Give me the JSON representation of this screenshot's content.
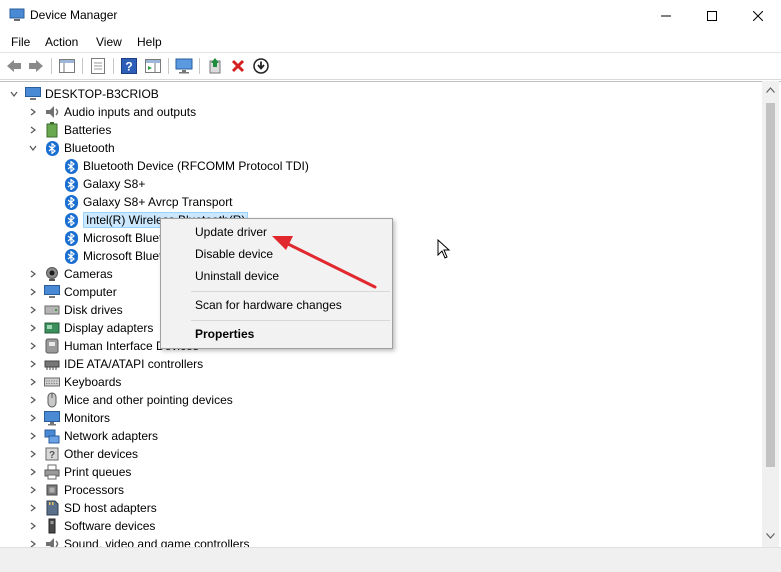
{
  "window": {
    "title": "Device Manager",
    "controls": {
      "minimize": "–",
      "maximize": "☐",
      "close": "✕"
    }
  },
  "menu": [
    "File",
    "Action",
    "View",
    "Help"
  ],
  "toolbar": {
    "buttons": [
      "back-icon",
      "forward-icon",
      "show-hide-console-tree-icon",
      "properties-icon",
      "help-icon",
      "action-pane-icon",
      "monitor-icon",
      "update-driver-icon",
      "uninstall-icon",
      "download-icon"
    ],
    "accent_colors": {
      "help": "#2e5fb8",
      "uninstall": "#d42020",
      "update": "#1e8e3e"
    }
  },
  "tree": {
    "root": "DESKTOP-B3CRIOB",
    "categories": [
      {
        "label": "Audio inputs and outputs",
        "icon": "speaker-icon"
      },
      {
        "label": "Batteries",
        "icon": "battery-icon"
      },
      {
        "label": "Bluetooth",
        "icon": "bluetooth-icon",
        "expanded": true
      },
      {
        "label": "Cameras",
        "icon": "camera-icon"
      },
      {
        "label": "Computer",
        "icon": "computer-icon"
      },
      {
        "label": "Disk drives",
        "icon": "disk-icon"
      },
      {
        "label": "Display adapters",
        "icon": "display-icon"
      },
      {
        "label": "Human Interface Devices",
        "icon": "hid-icon"
      },
      {
        "label": "IDE ATA/ATAPI controllers",
        "icon": "ide-icon"
      },
      {
        "label": "Keyboards",
        "icon": "keyboard-icon"
      },
      {
        "label": "Mice and other pointing devices",
        "icon": "mouse-icon"
      },
      {
        "label": "Monitors",
        "icon": "monitor-icon"
      },
      {
        "label": "Network adapters",
        "icon": "network-icon"
      },
      {
        "label": "Other devices",
        "icon": "unknown-device-icon"
      },
      {
        "label": "Print queues",
        "icon": "printer-icon"
      },
      {
        "label": "Processors",
        "icon": "cpu-icon"
      },
      {
        "label": "SD host adapters",
        "icon": "sd-icon"
      },
      {
        "label": "Software devices",
        "icon": "software-icon"
      },
      {
        "label": "Sound, video and game controllers",
        "icon": "sound-icon"
      }
    ],
    "bluetooth_children": [
      "Bluetooth Device (RFCOMM Protocol TDI)",
      "Galaxy S8+",
      "Galaxy S8+ Avrcp Transport",
      "Intel(R) Wireless Bluetooth(R)",
      "Microsoft Bluetooth Enumerator",
      "Microsoft Bluetooth LE Enumerator"
    ],
    "selected": "Intel(R) Wireless Bluetooth(R)"
  },
  "context_menu": {
    "items": [
      "Update driver",
      "Disable device",
      "Uninstall device",
      "Scan for hardware changes",
      "Properties"
    ]
  },
  "colors": {
    "selection": "#cce8ff",
    "bluetooth": "#1a6fd1",
    "arrow": "#e0282e"
  }
}
